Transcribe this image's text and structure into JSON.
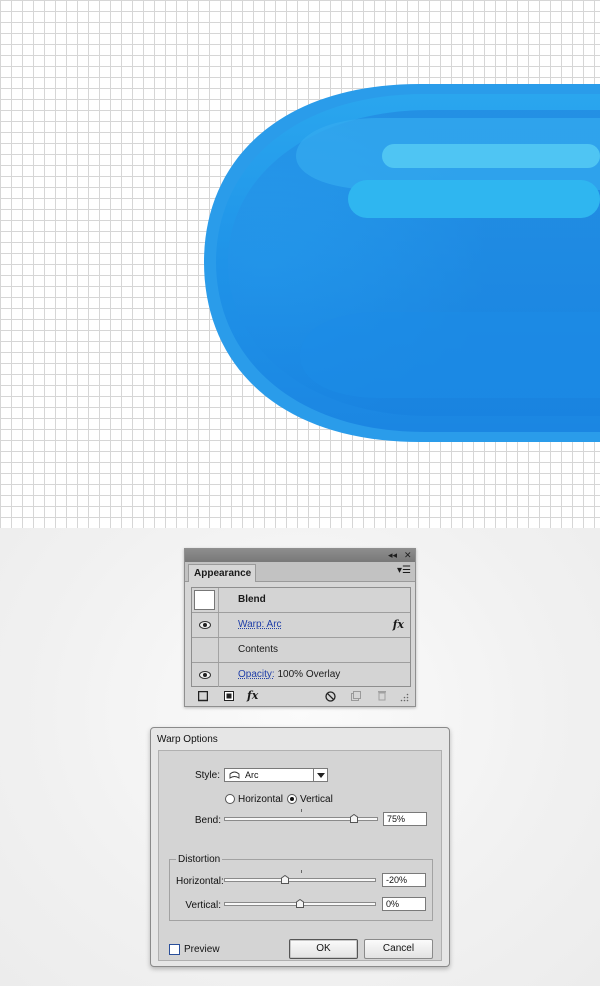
{
  "canvas": {
    "grid_color": "#d6d6d6",
    "shape_colors": [
      "#2aa3ec",
      "#1e8fe6",
      "#2196ea",
      "#2fb6f0",
      "#50c6f3"
    ]
  },
  "appearance": {
    "tab": "Appearance",
    "collapse_glyph": "◂◂",
    "close_glyph": "✕",
    "menu_glyph": "▾☰",
    "rows": [
      {
        "label": "Blend"
      },
      {
        "effect": "Warp: Arc",
        "fx": "fx"
      },
      {
        "label": "Contents"
      },
      {
        "prop": "Opacity:",
        "value": "100% Overlay"
      }
    ],
    "bottom_fx": "fx"
  },
  "warp": {
    "title": "Warp Options",
    "style_label": "Style:",
    "style_value": "Arc",
    "orientation": {
      "horizontal": "Horizontal",
      "vertical": "Vertical",
      "selected": "vertical"
    },
    "bend": {
      "label": "Bend:",
      "value": "75%",
      "level_percent": 75
    },
    "distortion_label": "Distortion",
    "horizontal": {
      "label": "Horizontal:",
      "value": "-20%",
      "level_percent": -20
    },
    "vertical": {
      "label": "Vertical:",
      "value": "0%",
      "level_percent": 0
    },
    "preview_label": "Preview",
    "ok_label": "OK",
    "cancel_label": "Cancel",
    "accent_color": "#2a4f9a"
  }
}
